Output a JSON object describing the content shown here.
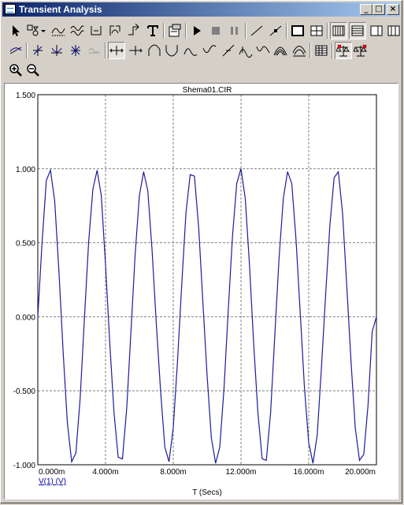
{
  "window": {
    "title": "Transient Analysis"
  },
  "title_buttons": {
    "minimize": "_",
    "maximize": "□",
    "close": "×"
  },
  "toolbar": {
    "row1": [
      "select-arrow-icon",
      "scale-shapes-icon",
      "dropdown-arrow-icon",
      "waveform-icon",
      "multi-wave-icon",
      "bracket-icon",
      "cursor-icon",
      "derivative-icon",
      "text-icon",
      "properties-icon",
      "run-icon",
      "stop-icon",
      "pause-icon",
      "line-icon",
      "dot-line-icon",
      "single-box-icon",
      "grid-box-icon",
      "vertical-lines-icon",
      "horizontal-lines-icon",
      "grid-columns-icon",
      "grid-columns-2-icon"
    ],
    "row2": [
      "tangent-icon",
      "slope-icon",
      "cross-icon",
      "marker-icon",
      "faded-wave-icon",
      "cursor-left-right-icon",
      "cursor-right-icon",
      "peak-icon",
      "valley-icon",
      "high-icon",
      "low-icon",
      "inflection-icon",
      "point-icon",
      "pulse-icon",
      "global-high-icon",
      "global-low-icon",
      "table-icon",
      "fixed-scale-icon",
      "auto-scale-icon"
    ],
    "row3": [
      "zoom-in-icon",
      "zoom-out-icon"
    ]
  },
  "colors": {
    "trace": "#1c1c9a",
    "grid": "#808080",
    "axis_label": "#0000aa"
  },
  "chart_data": {
    "type": "line",
    "title": "Shema01.CIR",
    "xlabel": "T (Secs)",
    "ylabel": "",
    "xlim": [
      0,
      0.02
    ],
    "ylim": [
      -1.0,
      1.5
    ],
    "grid": true,
    "x_ticks": [
      "0.000m",
      "4.000m",
      "8.000m",
      "12.000m",
      "16.000m",
      "20.000m"
    ],
    "y_ticks": [
      "1.500",
      "1.000",
      "0.500",
      "0.000",
      "-0.500",
      "-1.000"
    ],
    "series": [
      {
        "name": "V(1) (V)",
        "x": [
          0,
          0.00025,
          0.0005,
          0.00075,
          0.001,
          0.00125,
          0.0015,
          0.00175,
          0.002,
          0.00225,
          0.0025,
          0.00275,
          0.003,
          0.00325,
          0.0035,
          0.00375,
          0.004,
          0.00425,
          0.0045,
          0.00475,
          0.005,
          0.00525,
          0.0055,
          0.00575,
          0.006,
          0.00625,
          0.0065,
          0.00675,
          0.007,
          0.00725,
          0.0075,
          0.00775,
          0.008,
          0.00825,
          0.0085,
          0.00875,
          0.009,
          0.00925,
          0.0095,
          0.00975,
          0.01,
          0.01025,
          0.0105,
          0.01075,
          0.011,
          0.01125,
          0.0115,
          0.01175,
          0.012,
          0.01225,
          0.0125,
          0.01275,
          0.013,
          0.01325,
          0.0135,
          0.01375,
          0.014,
          0.01425,
          0.0145,
          0.01475,
          0.015,
          0.01525,
          0.0155,
          0.01575,
          0.016,
          0.01625,
          0.0165,
          0.01675,
          0.017,
          0.01725,
          0.0175,
          0.01775,
          0.018,
          0.01825,
          0.0185,
          0.01875,
          0.019,
          0.01925,
          0.0195,
          0.01975,
          0.02
        ],
        "y": [
          0,
          0.5,
          0.92,
          0.99,
          0.78,
          0.3,
          -0.25,
          -0.72,
          -0.98,
          -0.92,
          -0.55,
          -0.02,
          0.5,
          0.86,
          0.99,
          0.82,
          0.35,
          -0.18,
          -0.65,
          -0.95,
          -0.96,
          -0.62,
          -0.1,
          0.42,
          0.82,
          0.98,
          0.85,
          0.45,
          -0.05,
          -0.5,
          -0.88,
          -0.98,
          -0.75,
          -0.3,
          0.22,
          0.7,
          0.96,
          0.95,
          0.6,
          0.1,
          -0.4,
          -0.82,
          -0.99,
          -0.88,
          -0.48,
          0.05,
          0.55,
          0.9,
          1.0,
          0.8,
          0.35,
          -0.18,
          -0.65,
          -0.96,
          -0.97,
          -0.65,
          -0.12,
          0.4,
          0.8,
          0.98,
          0.9,
          0.52,
          0.02,
          -0.48,
          -0.85,
          -0.99,
          -0.8,
          -0.35,
          0.15,
          0.62,
          0.94,
          0.98,
          0.7,
          0.2,
          -0.3,
          -0.75,
          -0.97,
          -0.93,
          -0.6,
          -0.1,
          0
        ]
      }
    ]
  }
}
